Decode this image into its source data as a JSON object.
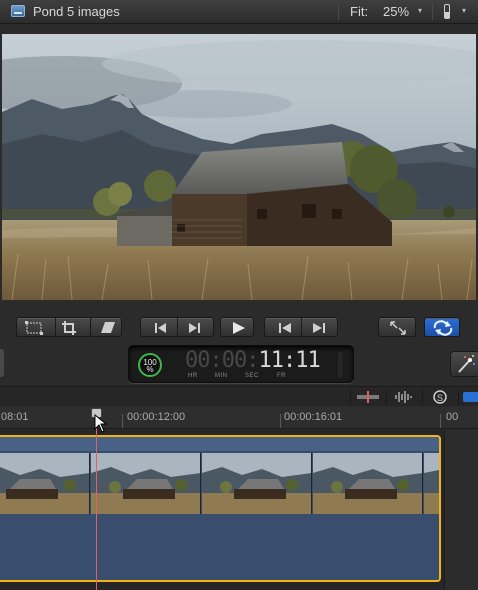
{
  "viewer": {
    "title": "Pond 5 images",
    "fit_label": "Fit:",
    "fit_value": "25%"
  },
  "transport": {
    "buttons": [
      "transform",
      "crop",
      "distort",
      "previous-frame",
      "next-frame",
      "play",
      "go-to-start",
      "go-to-end",
      "full-screen",
      "loop"
    ]
  },
  "timecode": {
    "percent": "100",
    "percent_sign": "%",
    "hours": "00",
    "minutes": "00",
    "seconds": "11",
    "frames": "11",
    "units": [
      "HR",
      "MIN",
      "SEC",
      "FR"
    ],
    "percent_ring_color": "#3fb54a"
  },
  "ruler": {
    "labels": [
      "08:01",
      "00:00:12:00",
      "00:00:16:01"
    ]
  },
  "timeline": {
    "clip_selection_color": "#f5b31a",
    "clip_color": "#374c68",
    "playhead_color": "#e06070"
  },
  "icons": [
    "clip-icon",
    "switch-icon",
    "transform-icon",
    "crop-icon",
    "distort-icon",
    "previous-frame-icon",
    "next-frame-icon",
    "play-icon",
    "go-to-start-icon",
    "go-to-end-icon",
    "full-screen-icon",
    "loop-icon",
    "magic-wand-icon",
    "skimming-icon",
    "audio-skimming-icon",
    "solo-icon",
    "snapping-icon",
    "mouse-pointer-icon"
  ]
}
